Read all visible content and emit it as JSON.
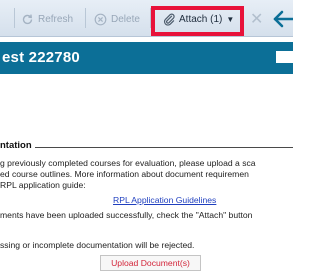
{
  "toolbar": {
    "refresh_label": "Refresh",
    "delete_label": "Delete",
    "attach_label": "Attach (1)",
    "attach_caret": "▼",
    "close_glyph": "✕"
  },
  "header": {
    "title": "est 222780"
  },
  "section": {
    "title": "ntation",
    "lines": [
      "g previously completed courses for evaluation, please upload a sca",
      "ed course outlines. More information about document requiremen",
      " RPL application guide:",
      "ments have been uploaded successfully, check the \"Attach\" button",
      "ssing or incomplete documentation will be rejected."
    ],
    "link_label": "RPL Application Guidelines",
    "upload_button_label": "Upload Document(s)"
  },
  "colors": {
    "title_bar": "#0c6f97",
    "highlight": "#e8123a",
    "link": "#1f3fbf",
    "upload_text": "#d3253a"
  }
}
